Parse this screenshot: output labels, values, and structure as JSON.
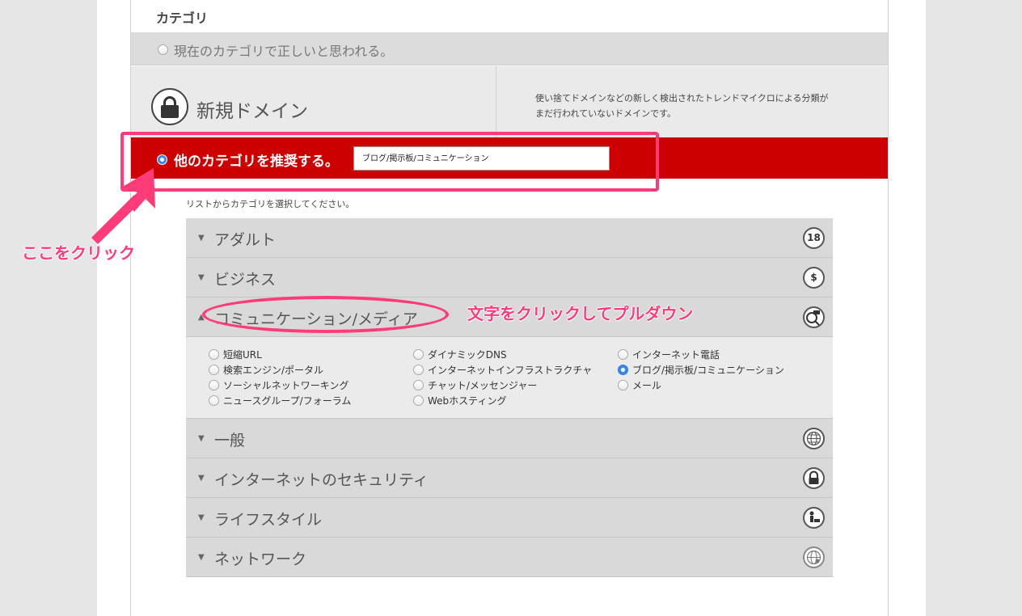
{
  "header": {
    "title": "カテゴリ"
  },
  "current": {
    "label": "現在のカテゴリで正しいと思われる。"
  },
  "domain": {
    "label": "新規ドメイン",
    "description": "使い捨てドメインなどの新しく検出されたトレンドマイクロによる分類がまだ行われていないドメインです。"
  },
  "suggest": {
    "label": "他のカテゴリを推奨する。",
    "value": "ブログ/掲示板/コミュニケーション"
  },
  "hint": "リストからカテゴリを選択してください。",
  "categories": [
    {
      "name": "アダルト",
      "icon": "18",
      "expanded": false
    },
    {
      "name": "ビジネス",
      "icon": "$",
      "expanded": false
    },
    {
      "name": "コミュニケーション/メディア",
      "icon": "?",
      "expanded": true
    },
    {
      "name": "一般",
      "icon": "globe-icon",
      "expanded": false
    },
    {
      "name": "インターネットのセキュリティ",
      "icon": "lock-icon",
      "expanded": false
    },
    {
      "name": "ライフスタイル",
      "icon": "person-icon",
      "expanded": false
    },
    {
      "name": "ネットワーク",
      "icon": "network-globe-icon",
      "expanded": false
    }
  ],
  "subcategories": {
    "col1": [
      "短縮URL",
      "検索エンジン/ポータル",
      "ソーシャルネットワーキング",
      "ニュースグループ/フォーラム"
    ],
    "col2": [
      "ダイナミックDNS",
      "インターネットインフラストラクチャ",
      "チャット/メッセンジャー",
      "Webホスティング"
    ],
    "col3": [
      "インターネット電話",
      "ブログ/掲示板/コミュニケーション",
      "メール"
    ],
    "selected": "ブログ/掲示板/コミュニケーション"
  },
  "annotations": {
    "click_here": "ここをクリック",
    "pulldown": "文字をクリックしてプルダウン"
  },
  "colors": {
    "accent_red": "#cc0000",
    "annotation_pink": "#ff3b79"
  }
}
